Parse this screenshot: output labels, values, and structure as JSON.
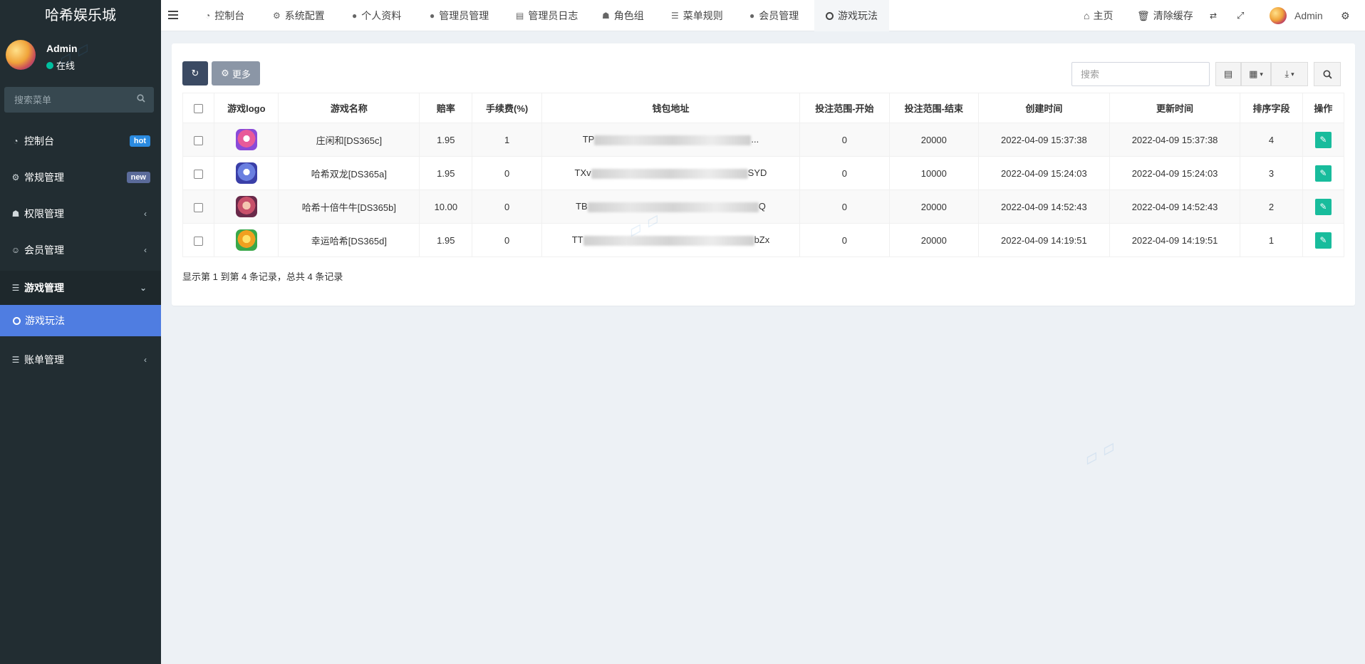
{
  "app": {
    "title": "哈希娱乐城"
  },
  "user": {
    "name": "Admin",
    "status": "在线"
  },
  "sidebar": {
    "search_placeholder": "搜索菜单",
    "items": [
      {
        "label": "控制台",
        "icon": "dashboard-icon",
        "badge": "hot"
      },
      {
        "label": "常规管理",
        "icon": "cogs-icon",
        "badge": "new"
      },
      {
        "label": "权限管理",
        "icon": "group-icon"
      },
      {
        "label": "会员管理",
        "icon": "user-circle-icon"
      },
      {
        "label": "游戏管理",
        "icon": "list-icon"
      },
      {
        "label": "游戏玩法",
        "icon": "circle-icon"
      },
      {
        "label": "账单管理",
        "icon": "list-icon"
      }
    ]
  },
  "topnav": {
    "tabs": [
      {
        "label": "控制台",
        "icon": "dashboard-icon"
      },
      {
        "label": "系统配置",
        "icon": "cog-icon"
      },
      {
        "label": "个人资料",
        "icon": "user-icon"
      },
      {
        "label": "管理员管理",
        "icon": "user-icon"
      },
      {
        "label": "管理员日志",
        "icon": "list-alt-icon"
      },
      {
        "label": "角色组",
        "icon": "group-icon"
      },
      {
        "label": "菜单规则",
        "icon": "bars-icon"
      },
      {
        "label": "会员管理",
        "icon": "user-icon"
      },
      {
        "label": "游戏玩法",
        "icon": "circle-icon"
      }
    ],
    "home": "主页",
    "clear_cache": "清除缓存",
    "admin": "Admin"
  },
  "toolbar": {
    "more": "更多",
    "search_placeholder": "搜索"
  },
  "table": {
    "columns": [
      "游戏logo",
      "游戏名称",
      "赔率",
      "手续费(%)",
      "钱包地址",
      "投注范围-开始",
      "投注范围-结束",
      "创建时间",
      "更新时间",
      "排序字段",
      "操作"
    ],
    "rows": [
      {
        "name": "庄闲和[DS365c]",
        "odds": "1.95",
        "fee": "1",
        "wallet_start": "TP",
        "wallet_end": "...",
        "bet_start": "0",
        "bet_end": "20000",
        "created": "2022-04-09 15:37:38",
        "updated": "2022-04-09 15:37:38",
        "sort": "4"
      },
      {
        "name": "哈希双龙[DS365a]",
        "odds": "1.95",
        "fee": "0",
        "wallet_start": "TXv",
        "wallet_end": "SYD",
        "bet_start": "0",
        "bet_end": "10000",
        "created": "2022-04-09 15:24:03",
        "updated": "2022-04-09 15:24:03",
        "sort": "3"
      },
      {
        "name": "哈希十倍牛牛[DS365b]",
        "odds": "10.00",
        "fee": "0",
        "wallet_start": "TB",
        "wallet_end": "Q",
        "bet_start": "0",
        "bet_end": "20000",
        "created": "2022-04-09 14:52:43",
        "updated": "2022-04-09 14:52:43",
        "sort": "2"
      },
      {
        "name": "幸运哈希[DS365d]",
        "odds": "1.95",
        "fee": "0",
        "wallet_start": "TT",
        "wallet_end": "bZx",
        "bet_start": "0",
        "bet_end": "20000",
        "created": "2022-04-09 14:19:51",
        "updated": "2022-04-09 14:19:51",
        "sort": "1"
      }
    ],
    "footer": "显示第 1 到第 4 条记录，总共 4 条记录"
  },
  "colors": {
    "sidebar_bg": "#222d32",
    "active_menu": "#4f7de1",
    "edit_button": "#18bc9c"
  }
}
